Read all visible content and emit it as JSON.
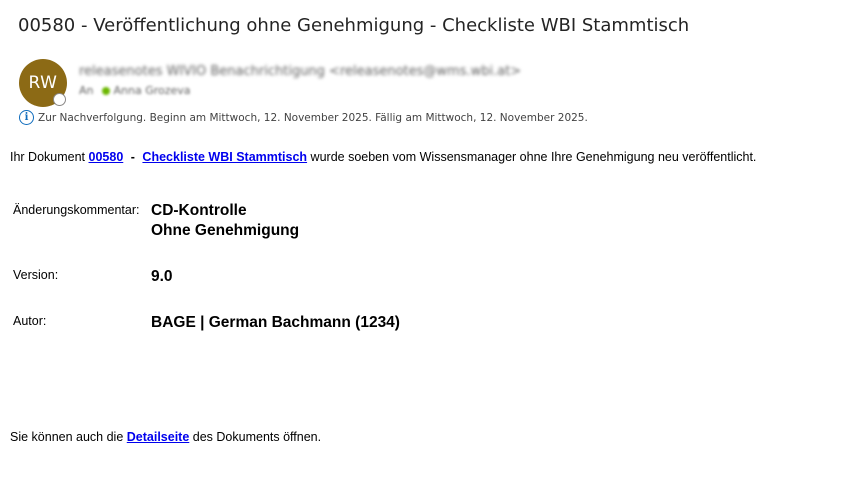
{
  "email": {
    "subject": "00580 - Veröffentlichung ohne Genehmigung - Checkliste WBI Stammtisch",
    "avatar_initials": "RW",
    "sender": "releasenotes WIVIO Benachrichtigung <releasenotes@wms.wbi.at>",
    "to_label": "An",
    "recipient": "Anna Grozeva",
    "followup_text": "Zur Nachverfolgung.  Beginn am Mittwoch, 12. November 2025.  Fällig am Mittwoch, 12. November 2025."
  },
  "body": {
    "intro_prefix": "Ihr Dokument",
    "doc_number": "00580",
    "separator": "-",
    "doc_title": "Checkliste WBI Stammtisch",
    "intro_suffix": "wurde soeben vom Wissensmanager ohne Ihre Genehmigung neu veröffentlicht.",
    "comment_label": "Änderungskommentar:",
    "comment_line1": "CD-Kontrolle",
    "comment_line2": "Ohne Genehmigung",
    "version_label": "Version:",
    "version_value": "9.0",
    "author_label": "Autor:",
    "author_value": "BAGE | German Bachmann (1234)",
    "closing_prefix": "Sie können auch die",
    "detail_link": "Detailseite",
    "closing_suffix": "des Dokuments öffnen."
  },
  "colors": {
    "avatar_bg": "#8c6a15",
    "link": "#0000ee",
    "info_icon": "#0f6cbd",
    "presence_online": "#6bb700"
  },
  "icons": {
    "followup": "info-icon",
    "presence": "presence-status-icon"
  }
}
